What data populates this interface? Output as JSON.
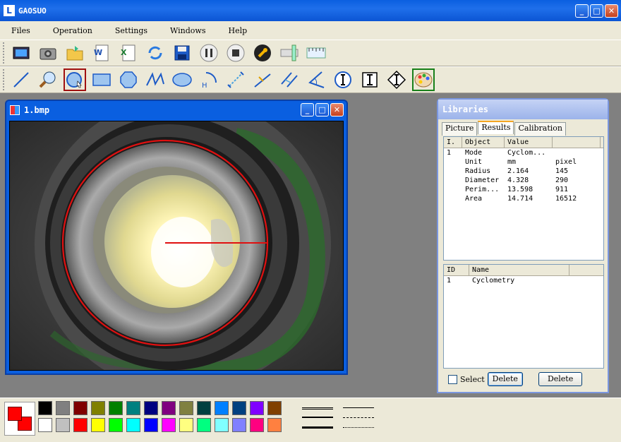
{
  "app": {
    "title": "GAOSUO",
    "logo_letter": "L"
  },
  "window_buttons": {
    "minimize": "_",
    "maximize": "□",
    "close": "✕"
  },
  "menu": [
    "Files",
    "Operation",
    "Settings",
    "Windows",
    "Help"
  ],
  "toolbar1": [
    "video-icon",
    "camera-icon",
    "open-folder-icon",
    "word-export-icon",
    "excel-export-icon",
    "refresh-icon",
    "save-icon",
    "pause-icon",
    "stop-icon",
    "wrench-icon",
    "ruler-vertical-icon",
    "ruler-horizontal-icon"
  ],
  "toolbar2": [
    "line-tool-icon",
    "zoom-icon",
    "circle-tool-icon",
    "rectangle-tool-icon",
    "polygon-tool-icon",
    "polyline-tool-icon",
    "ellipse-tool-icon",
    "arc-height-icon",
    "distance-icon",
    "point-line-icon",
    "parallel-distance-icon",
    "angle-tool-icon",
    "vertical-measure-icon",
    "width-measure-icon",
    "diamond-measure-icon",
    "palette-icon"
  ],
  "image_window": {
    "title": "1.bmp",
    "circle_color": "#e01010"
  },
  "libraries": {
    "title": "Libraries",
    "tabs": [
      "Picture",
      "Results",
      "Calibration"
    ],
    "active_tab": "Results",
    "results_header": [
      "I.",
      "Object",
      "Value",
      ""
    ],
    "results_rows": [
      [
        "1",
        "Mode",
        "Cyclom...",
        ""
      ],
      [
        "",
        "Unit",
        "mm",
        "pixel"
      ],
      [
        "",
        "Radius",
        "2.164",
        "145"
      ],
      [
        "",
        "Diameter",
        "4.328",
        "290"
      ],
      [
        "",
        "Perim...",
        "13.598",
        "911"
      ],
      [
        "",
        "Area",
        "14.714",
        "16512"
      ]
    ],
    "objects_header": [
      "ID",
      "Name"
    ],
    "objects_rows": [
      [
        "1",
        "Cyclometry"
      ]
    ],
    "select_label": "Select",
    "delete_label": "Delete",
    "delete_all_label": "Delete"
  },
  "palette": {
    "current_fg": "#ff0000",
    "current_bg": "#ff0000",
    "colors": [
      "#000000",
      "#808080",
      "#800000",
      "#808000",
      "#008000",
      "#008080",
      "#000080",
      "#800080",
      "#808040",
      "#004040",
      "#0080ff",
      "#004080",
      "#8000ff",
      "#804000",
      "#ffffff",
      "#c0c0c0",
      "#ff0000",
      "#ffff00",
      "#00ff00",
      "#00ffff",
      "#0000ff",
      "#ff00ff",
      "#ffff80",
      "#00ff80",
      "#80ffff",
      "#8080ff",
      "#ff0080",
      "#ff8040"
    ]
  }
}
